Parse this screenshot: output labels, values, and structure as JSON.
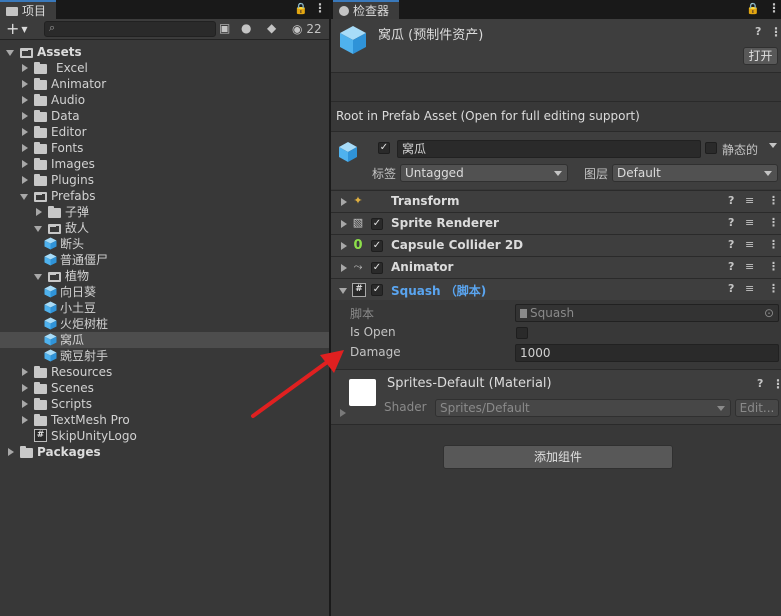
{
  "project": {
    "tab_label": "项目",
    "hidden_count": "22",
    "search_placeholder": "",
    "tree": [
      {
        "label": "Assets",
        "depth": 0,
        "expanded": true,
        "bold": true,
        "type": "folder"
      },
      {
        "label": "Excel",
        "depth": 1,
        "expanded": false,
        "type": "folder"
      },
      {
        "label": "Animator",
        "depth": 1,
        "expanded": false,
        "type": "folder"
      },
      {
        "label": "Audio",
        "depth": 1,
        "expanded": false,
        "type": "folder"
      },
      {
        "label": "Data",
        "depth": 1,
        "expanded": false,
        "type": "folder"
      },
      {
        "label": "Editor",
        "depth": 1,
        "expanded": false,
        "type": "folder"
      },
      {
        "label": "Fonts",
        "depth": 1,
        "expanded": false,
        "type": "folder"
      },
      {
        "label": "Images",
        "depth": 1,
        "expanded": false,
        "type": "folder"
      },
      {
        "label": "Plugins",
        "depth": 1,
        "expanded": false,
        "type": "folder"
      },
      {
        "label": "Prefabs",
        "depth": 1,
        "expanded": true,
        "type": "folder"
      },
      {
        "label": "子弹",
        "depth": 2,
        "expanded": false,
        "type": "folder"
      },
      {
        "label": "敌人",
        "depth": 2,
        "expanded": true,
        "type": "folder"
      },
      {
        "label": "断头",
        "depth": 3,
        "type": "prefab"
      },
      {
        "label": "普通僵尸",
        "depth": 3,
        "type": "prefab"
      },
      {
        "label": "植物",
        "depth": 2,
        "expanded": true,
        "type": "folder"
      },
      {
        "label": "向日葵",
        "depth": 3,
        "type": "prefab"
      },
      {
        "label": "小土豆",
        "depth": 3,
        "type": "prefab"
      },
      {
        "label": "火炬树桩",
        "depth": 3,
        "type": "prefab"
      },
      {
        "label": "窝瓜",
        "depth": 3,
        "type": "prefab",
        "selected": true
      },
      {
        "label": "豌豆射手",
        "depth": 3,
        "type": "prefab"
      },
      {
        "label": "Resources",
        "depth": 1,
        "expanded": false,
        "type": "folder"
      },
      {
        "label": "Scenes",
        "depth": 1,
        "expanded": false,
        "type": "folder"
      },
      {
        "label": "Scripts",
        "depth": 1,
        "expanded": false,
        "type": "folder"
      },
      {
        "label": "TextMesh Pro",
        "depth": 1,
        "expanded": false,
        "type": "folder"
      },
      {
        "label": "SkipUnityLogo",
        "depth": 1,
        "type": "script"
      },
      {
        "label": "Packages",
        "depth": 0,
        "expanded": false,
        "bold": true,
        "type": "folder"
      }
    ]
  },
  "inspector": {
    "tab_label": "检查器",
    "asset_title": "窝瓜 (预制件资产)",
    "open_button": "打开",
    "prefab_note": "Root in Prefab Asset (Open for full editing support)",
    "name_value": "窝瓜",
    "static_label": "静态的",
    "tag_label": "标签",
    "tag_value": "Untagged",
    "layer_label": "图层",
    "layer_value": "Default",
    "components": [
      {
        "title": "Transform",
        "icon": "transform-icon",
        "has_checkbox": false
      },
      {
        "title": "Sprite Renderer",
        "icon": "sprite-renderer-icon",
        "has_checkbox": true
      },
      {
        "title": "Capsule Collider 2D",
        "icon": "capsule-collider-icon",
        "has_checkbox": true
      },
      {
        "title": "Animator",
        "icon": "animator-icon",
        "has_checkbox": true
      },
      {
        "title": "Squash （脚本)",
        "icon": "script-icon",
        "has_checkbox": true,
        "expanded": true
      }
    ],
    "script_fields": {
      "script_label": "脚本",
      "script_value": "Squash",
      "is_open_label": "Is Open",
      "damage_label": "Damage",
      "damage_value": "1000"
    },
    "material": {
      "title": "Sprites-Default (Material)",
      "shader_label": "Shader",
      "shader_value": "Sprites/Default",
      "edit_button": "Edit..."
    },
    "add_component_button": "添加组件"
  },
  "annotation": {
    "color": "#e02020"
  }
}
